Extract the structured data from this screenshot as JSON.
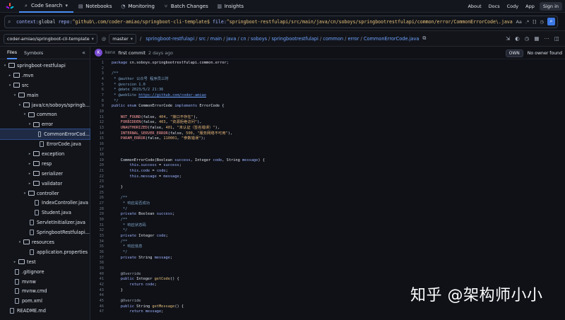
{
  "nav": {
    "items": [
      {
        "name": "code-search",
        "label": "Code Search",
        "icon": "search-icon",
        "dropdown": true
      },
      {
        "name": "notebooks",
        "label": "Notebooks",
        "icon": "notebook-icon"
      },
      {
        "name": "monitoring",
        "label": "Monitoring",
        "icon": "monitoring-icon"
      },
      {
        "name": "batch-changes",
        "label": "Batch Changes",
        "icon": "batch-changes-icon"
      },
      {
        "name": "insights",
        "label": "Insights",
        "icon": "insights-icon"
      }
    ],
    "right": {
      "about": "About",
      "docs": "Docs",
      "cody": "Cody",
      "app": "App",
      "signin": "Sign in"
    }
  },
  "search": {
    "context_kw": "context:",
    "context_val": "global",
    "repo_kw": "repo:",
    "repo_val": "^github\\.com/coder-amiao/springboot-cli-template$",
    "file_kw": "file:",
    "file_val": "^springboot-restfulapi/src/main/java/cn/soboys/springbootrestfulapi/common/error/CommonErrorCode\\.java",
    "tools": {
      "case": "Aa",
      "regex": ".*",
      "structural": "[]"
    }
  },
  "repo": {
    "name": "coder-amiao/springboot-cli-template",
    "branch": "master",
    "path": [
      "springboot-restfulapi",
      "src",
      "main",
      "java",
      "cn",
      "soboys",
      "springbootrestfulapi",
      "common",
      "error",
      "CommonErrorCode.java"
    ]
  },
  "sidebar": {
    "tabs": {
      "files": "Files",
      "symbols": "Symbols"
    },
    "tree": [
      {
        "label": "springboot-restfulapi",
        "depth": 0,
        "type": "folder",
        "open": true
      },
      {
        "label": ".mvn",
        "depth": 1,
        "type": "folder",
        "open": false
      },
      {
        "label": "src",
        "depth": 1,
        "type": "folder",
        "open": true
      },
      {
        "label": "main",
        "depth": 2,
        "type": "folder",
        "open": true
      },
      {
        "label": "java/cn/soboys/springb...",
        "depth": 3,
        "type": "folder",
        "open": true
      },
      {
        "label": "common",
        "depth": 4,
        "type": "folder",
        "open": true
      },
      {
        "label": "error",
        "depth": 5,
        "type": "folder",
        "open": true
      },
      {
        "label": "CommonErrorCod...",
        "depth": 6,
        "type": "file",
        "selected": true
      },
      {
        "label": "ErrorCode.java",
        "depth": 6,
        "type": "file"
      },
      {
        "label": "exception",
        "depth": 5,
        "type": "folder",
        "open": false
      },
      {
        "label": "resp",
        "depth": 5,
        "type": "folder",
        "open": false
      },
      {
        "label": "serializer",
        "depth": 5,
        "type": "folder",
        "open": false
      },
      {
        "label": "validator",
        "depth": 5,
        "type": "folder",
        "open": false
      },
      {
        "label": "controller",
        "depth": 4,
        "type": "folder",
        "open": true
      },
      {
        "label": "IndexController.java",
        "depth": 5,
        "type": "file"
      },
      {
        "label": "Student.java",
        "depth": 5,
        "type": "file"
      },
      {
        "label": "ServletInitializer.java",
        "depth": 4,
        "type": "file"
      },
      {
        "label": "SpringbootRestfulapi...",
        "depth": 4,
        "type": "file"
      },
      {
        "label": "resources",
        "depth": 3,
        "type": "folder",
        "open": true
      },
      {
        "label": "application.properties",
        "depth": 4,
        "type": "file"
      },
      {
        "label": "test",
        "depth": 2,
        "type": "folder",
        "open": false
      },
      {
        "label": ".gitignore",
        "depth": 1,
        "type": "file"
      },
      {
        "label": "mvnw",
        "depth": 1,
        "type": "file"
      },
      {
        "label": "mvnw.cmd",
        "depth": 1,
        "type": "file"
      },
      {
        "label": "pom.xml",
        "depth": 1,
        "type": "file"
      },
      {
        "label": "README.md",
        "depth": 0,
        "type": "file"
      }
    ]
  },
  "commit": {
    "avatar": "K",
    "author": "kenx",
    "message": "first commit",
    "when": "2 days ago"
  },
  "owner": {
    "chip": "OWN",
    "text": "No owner found"
  },
  "code": [
    {
      "n": "1",
      "t": [
        [
          "kw",
          "package "
        ],
        [
          "pl",
          "cn.soboys.springbootrestfulapi.common.error;"
        ]
      ]
    },
    {
      "n": "2",
      "t": []
    },
    {
      "n": "3",
      "t": [
        [
          "cm",
          "/**"
        ]
      ]
    },
    {
      "n": "4",
      "t": [
        [
          "cm",
          " * @author 公众号 程序员三时"
        ]
      ]
    },
    {
      "n": "5",
      "t": [
        [
          "cm",
          " * @version 1.0"
        ]
      ]
    },
    {
      "n": "6",
      "t": [
        [
          "cm",
          " * @date 2023/5/2 21:36"
        ]
      ]
    },
    {
      "n": "7",
      "t": [
        [
          "cm",
          " * @webSite "
        ],
        [
          "url",
          "https://github.com/coder-amiao"
        ]
      ]
    },
    {
      "n": "8",
      "t": [
        [
          "cm",
          " */"
        ]
      ]
    },
    {
      "n": "9",
      "t": [
        [
          "kw",
          "public enum "
        ],
        [
          "pl",
          "CommonErrorCode "
        ],
        [
          "kw",
          "implements "
        ],
        [
          "pl",
          "ErrorCode {"
        ]
      ]
    },
    {
      "n": "10",
      "t": []
    },
    {
      "n": "11",
      "t": [
        [
          "pl",
          "    "
        ],
        [
          "const",
          "NOT_FOUND"
        ],
        [
          "pl",
          "(false, "
        ],
        [
          "num",
          "404"
        ],
        [
          "pl",
          ", "
        ],
        [
          "str",
          "\"接口不存在\""
        ],
        [
          "pl",
          "),"
        ]
      ]
    },
    {
      "n": "12",
      "t": [
        [
          "pl",
          "    "
        ],
        [
          "const",
          "FORBIDDEN"
        ],
        [
          "pl",
          "(false, "
        ],
        [
          "num",
          "403"
        ],
        [
          "pl",
          ", "
        ],
        [
          "str",
          "\"资源拒绝访问\""
        ],
        [
          "pl",
          "),"
        ]
      ]
    },
    {
      "n": "13",
      "t": [
        [
          "pl",
          "    "
        ],
        [
          "const",
          "UNAUTHORIZED"
        ],
        [
          "pl",
          "(false, "
        ],
        [
          "num",
          "401"
        ],
        [
          "pl",
          ", "
        ],
        [
          "str",
          "\"未认证（签名错误）\""
        ],
        [
          "pl",
          "),"
        ]
      ]
    },
    {
      "n": "14",
      "t": [
        [
          "pl",
          "    "
        ],
        [
          "const",
          "INTERNAL_SERVER_ERROR"
        ],
        [
          "pl",
          "(false, "
        ],
        [
          "num",
          "500"
        ],
        [
          "pl",
          ", "
        ],
        [
          "str",
          "\"服务网络不可用\""
        ],
        [
          "pl",
          "),"
        ]
      ]
    },
    {
      "n": "15",
      "t": [
        [
          "pl",
          "    "
        ],
        [
          "const",
          "PARAM_ERROR"
        ],
        [
          "pl",
          "(false, "
        ],
        [
          "num",
          "110001"
        ],
        [
          "pl",
          ", "
        ],
        [
          "str",
          "\"参数错误\""
        ],
        [
          "pl",
          ");"
        ]
      ]
    },
    {
      "n": "16",
      "t": []
    },
    {
      "n": "17",
      "t": []
    },
    {
      "n": "18",
      "t": []
    },
    {
      "n": "19",
      "t": [
        [
          "pl",
          "    CommonErrorCode(Boolean "
        ],
        [
          "kw",
          "success"
        ],
        [
          "pl",
          ", Integer "
        ],
        [
          "kw",
          "code"
        ],
        [
          "pl",
          ", String "
        ],
        [
          "kw",
          "message"
        ],
        [
          "pl",
          ") {"
        ]
      ]
    },
    {
      "n": "20",
      "t": [
        [
          "pl",
          "        "
        ],
        [
          "kw",
          "this"
        ],
        [
          "pl",
          "."
        ],
        [
          "kw",
          "success"
        ],
        [
          "pl",
          " = "
        ],
        [
          "kw",
          "success"
        ],
        [
          "pl",
          ";"
        ]
      ]
    },
    {
      "n": "21",
      "t": [
        [
          "pl",
          "        "
        ],
        [
          "kw",
          "this"
        ],
        [
          "pl",
          "."
        ],
        [
          "kw",
          "code"
        ],
        [
          "pl",
          " = "
        ],
        [
          "kw",
          "code"
        ],
        [
          "pl",
          ";"
        ]
      ]
    },
    {
      "n": "22",
      "t": [
        [
          "pl",
          "        "
        ],
        [
          "kw",
          "this"
        ],
        [
          "pl",
          "."
        ],
        [
          "kw",
          "message"
        ],
        [
          "pl",
          " = "
        ],
        [
          "kw",
          "message"
        ],
        [
          "pl",
          ";"
        ]
      ]
    },
    {
      "n": "23",
      "t": []
    },
    {
      "n": "24",
      "t": [
        [
          "pl",
          "    }"
        ]
      ]
    },
    {
      "n": "25",
      "t": []
    },
    {
      "n": "26",
      "t": [
        [
          "cm",
          "    /**"
        ]
      ]
    },
    {
      "n": "27",
      "t": [
        [
          "cm",
          "     * 响应是否成功"
        ]
      ]
    },
    {
      "n": "28",
      "t": [
        [
          "cm",
          "     */"
        ]
      ]
    },
    {
      "n": "29",
      "t": [
        [
          "pl",
          "    "
        ],
        [
          "kw",
          "private "
        ],
        [
          "pl",
          "Boolean "
        ],
        [
          "kw",
          "success"
        ],
        [
          "pl",
          ";"
        ]
      ]
    },
    {
      "n": "30",
      "t": [
        [
          "cm",
          "    /**"
        ]
      ]
    },
    {
      "n": "31",
      "t": [
        [
          "cm",
          "     * 响应状态码"
        ]
      ]
    },
    {
      "n": "32",
      "t": [
        [
          "cm",
          "     */"
        ]
      ]
    },
    {
      "n": "33",
      "t": [
        [
          "pl",
          "    "
        ],
        [
          "kw",
          "private "
        ],
        [
          "pl",
          "Integer "
        ],
        [
          "kw",
          "code"
        ],
        [
          "pl",
          ";"
        ]
      ]
    },
    {
      "n": "34",
      "t": [
        [
          "cm",
          "    /**"
        ]
      ]
    },
    {
      "n": "35",
      "t": [
        [
          "cm",
          "     * 响应信息"
        ]
      ]
    },
    {
      "n": "36",
      "t": [
        [
          "cm",
          "     */"
        ]
      ]
    },
    {
      "n": "37",
      "t": [
        [
          "pl",
          "    "
        ],
        [
          "kw",
          "private "
        ],
        [
          "pl",
          "String "
        ],
        [
          "kw",
          "message"
        ],
        [
          "pl",
          ";"
        ]
      ]
    },
    {
      "n": "38",
      "t": []
    },
    {
      "n": "39",
      "t": []
    },
    {
      "n": "40",
      "t": [
        [
          "ann",
          "    @Override"
        ]
      ]
    },
    {
      "n": "41",
      "t": [
        [
          "pl",
          "    "
        ],
        [
          "kw",
          "public "
        ],
        [
          "pl",
          "Integer "
        ],
        [
          "fn",
          "getCode"
        ],
        [
          "pl",
          "() {"
        ]
      ]
    },
    {
      "n": "42",
      "t": [
        [
          "pl",
          "        "
        ],
        [
          "kw",
          "return "
        ],
        [
          "kw",
          "code"
        ],
        [
          "pl",
          ";"
        ]
      ]
    },
    {
      "n": "43",
      "t": [
        [
          "pl",
          "    }"
        ]
      ]
    },
    {
      "n": "44",
      "t": []
    },
    {
      "n": "45",
      "t": [
        [
          "ann",
          "    @Override"
        ]
      ]
    },
    {
      "n": "46",
      "t": [
        [
          "pl",
          "    "
        ],
        [
          "kw",
          "public "
        ],
        [
          "pl",
          "String "
        ],
        [
          "fn",
          "getMessage"
        ],
        [
          "pl",
          "() {"
        ]
      ]
    },
    {
      "n": "47",
      "t": [
        [
          "pl",
          "        "
        ],
        [
          "kw",
          "return "
        ],
        [
          "kw",
          "message"
        ],
        [
          "pl",
          ";"
        ]
      ]
    }
  ],
  "watermark": "知乎 @架构师小小",
  "colors": {
    "accent": "#4c8ef7",
    "background": "#0f1117",
    "link": "#6fa3ff"
  }
}
